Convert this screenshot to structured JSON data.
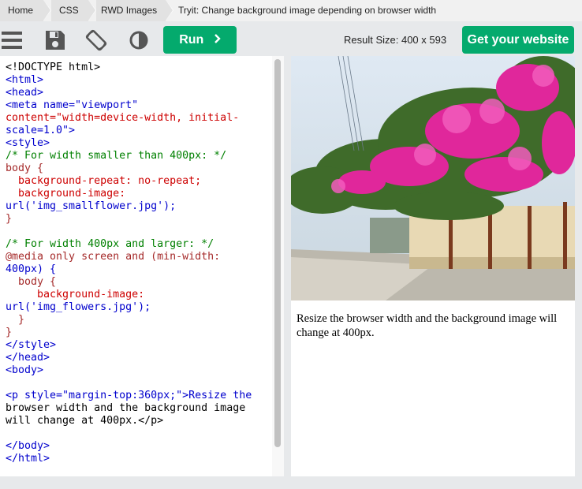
{
  "breadcrumb": {
    "items": [
      "Home",
      "CSS",
      "RWD Images"
    ],
    "current": "Tryit: Change background image depending on browser width"
  },
  "toolbar": {
    "run_label": "Run",
    "result_size": "Result Size: 400 x 593",
    "get_website_label": "Get your website"
  },
  "editor": {
    "lines": [
      "<!DOCTYPE html>",
      "<html>",
      "<head>",
      "<meta name=\"viewport\"",
      "content=\"width=device-width, initial-",
      "scale=1.0\">",
      "<style>",
      "/* For width smaller than 400px: */",
      "body {",
      "  background-repeat: no-repeat;",
      "  background-image:",
      "url('img_smallflower.jpg');",
      "}",
      "",
      "/* For width 400px and larger: */",
      "@media only screen and (min-width:",
      "400px) {",
      "  body {",
      "     background-image:",
      "url('img_flowers.jpg');",
      "  }",
      "}",
      "</style>",
      "</head>",
      "<body>",
      "",
      "<p style=\"margin-top:360px;\">Resize the",
      "browser width and the background image",
      "will change at 400px.</p>",
      "",
      "</body>",
      "</html>"
    ]
  },
  "result": {
    "paragraph": "Resize the browser width and the background image will change at 400px."
  },
  "colors": {
    "accent": "#04aa6d",
    "tag": "#0000cd",
    "attribute": "#cd0000",
    "comment": "#008000"
  },
  "icons": [
    "menu-icon",
    "save-icon",
    "rotate-icon",
    "contrast-icon",
    "chevron-right-icon"
  ]
}
